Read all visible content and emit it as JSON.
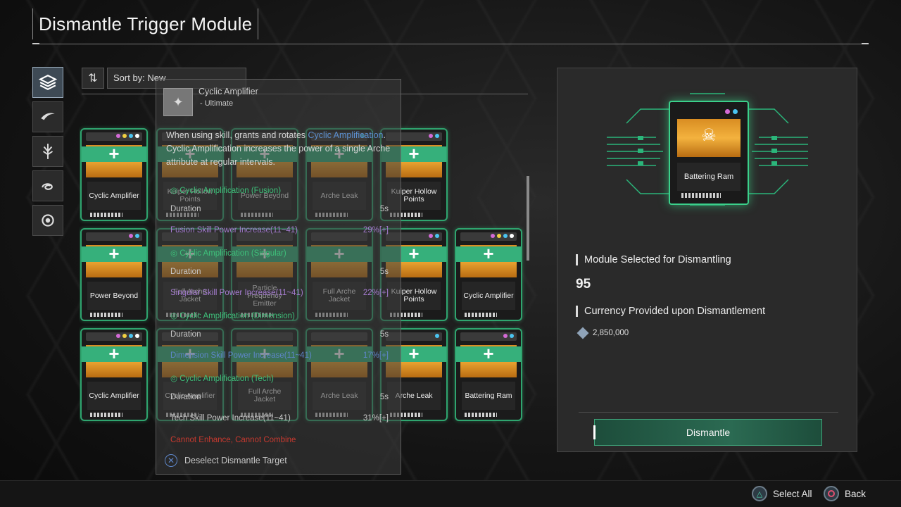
{
  "header": {
    "title": "Dismantle Trigger Module"
  },
  "sort": {
    "label": "Sort by: New"
  },
  "categories": [
    {
      "name": "all-modules-icon",
      "active": true
    },
    {
      "name": "slash-icon",
      "active": false
    },
    {
      "name": "claw-icon",
      "active": false
    },
    {
      "name": "swirl-icon",
      "active": false
    },
    {
      "name": "shell-icon",
      "active": false
    }
  ],
  "grid": {
    "rows": [
      [
        {
          "label": "Cyclic Amplifier",
          "dots": [
            "#d36ad6",
            "#f0d040",
            "#4ac4f0",
            "#ffffff"
          ]
        },
        {
          "label": "Kuiper Hollow Points",
          "dots": []
        },
        {
          "label": "Power Beyond",
          "dots": []
        },
        {
          "label": "Arche Leak",
          "dots": [
            "#4ac4f0"
          ]
        },
        {
          "label": "Kuiper Hollow Points",
          "dots": [
            "#d36ad6",
            "#4ac4f0"
          ]
        }
      ],
      [
        {
          "label": "Power Beyond",
          "dots": [
            "#d36ad6",
            "#4ac4f0"
          ]
        },
        {
          "label": "Full Arche Jacket",
          "dots": []
        },
        {
          "label": "Particle Frequency Emitter",
          "dots": []
        },
        {
          "label": "Full Arche Jacket",
          "dots": []
        },
        {
          "label": "Kuiper Hollow Points",
          "dots": [
            "#d36ad6",
            "#4ac4f0"
          ]
        },
        {
          "label": "Cyclic Amplifier",
          "dots": [
            "#d36ad6",
            "#f0d040",
            "#4ac4f0",
            "#ffffff"
          ]
        }
      ],
      [
        {
          "label": "Cyclic Amplifier",
          "dots": [
            "#d36ad6",
            "#f0d040",
            "#4ac4f0",
            "#ffffff"
          ]
        },
        {
          "label": "Cyclic Amplifier",
          "dots": []
        },
        {
          "label": "Full Arche Jacket",
          "dots": []
        },
        {
          "label": "Arche Leak",
          "dots": []
        },
        {
          "label": "Arche Leak",
          "dots": [
            "#4ac4f0"
          ]
        },
        {
          "label": "Battering Ram",
          "dots": [
            "#d36ad6",
            "#4ac4f0"
          ]
        }
      ]
    ]
  },
  "tooltip": {
    "name": "Cyclic Amplifier",
    "grade": "- Ultimate",
    "desc_1": "When using skill, grants and rotates",
    "desc_hl": "Cyclic Amplification",
    "desc_2": ". Cyclic Amplification increases the power of a single Arche attribute at regular intervals.",
    "effects": [
      {
        "title": "Cyclic Amplification (Fusion)",
        "duration_label": "Duration",
        "duration": "5s",
        "stat": "Fusion Skill Power Increase(11~41)",
        "value": "29%[+]",
        "stat_color": "purple"
      },
      {
        "title": "Cyclic Amplification (Singular)",
        "duration_label": "Duration",
        "duration": "5s",
        "stat": "Singular Skill Power Increase(11~41)",
        "value": "22%[+]",
        "stat_color": "purple"
      },
      {
        "title": "Cyclic Amplification (Dimension)",
        "duration_label": "Duration",
        "duration": "5s",
        "stat": "Dimension Skill Power Increase(11~41)",
        "value": "17%[+]",
        "stat_color": "blue"
      },
      {
        "title": "Cyclic Amplification (Tech)",
        "duration_label": "Duration",
        "duration": "5s",
        "stat": "Tech Skill Power Increase(11~41)",
        "value": "31%[+]",
        "stat_color": "grey"
      }
    ],
    "warning": "Cannot Enhance, Cannot Combine",
    "deselect": "Deselect Dismantle Target"
  },
  "panel": {
    "selected_card": {
      "label": "Battering Ram",
      "dots": [
        "#d36ad6",
        "#4ac4f0"
      ]
    },
    "selected_title": "Module Selected for Dismantling",
    "selected_count": "95",
    "currency_title": "Currency Provided upon Dismantlement",
    "currency_amount": "2,850,000",
    "dismantle_label": "Dismantle"
  },
  "footer": {
    "select_all": "Select All",
    "back": "Back"
  }
}
